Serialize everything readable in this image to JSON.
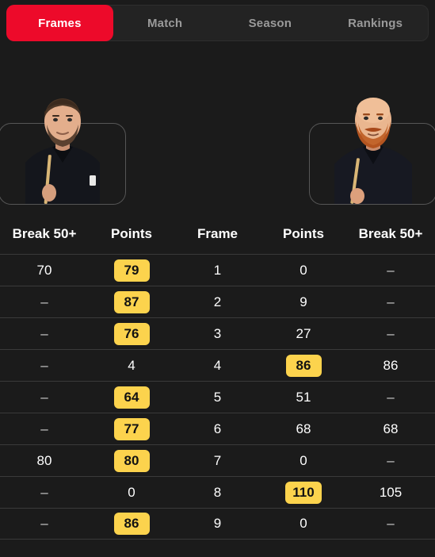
{
  "tabs": [
    {
      "label": "Frames",
      "active": true
    },
    {
      "label": "Match",
      "active": false
    },
    {
      "label": "Season",
      "active": false
    },
    {
      "label": "Rankings",
      "active": false
    }
  ],
  "players": {
    "left": {
      "icon": "player-photo-left",
      "description": "snooker player with dark hair and beard holding cue"
    },
    "right": {
      "icon": "player-photo-right",
      "description": "bald snooker player with ginger beard and bow tie holding cue"
    }
  },
  "table": {
    "headers": [
      "Break 50+",
      "Points",
      "Frame",
      "Points",
      "Break 50+"
    ],
    "rows": [
      {
        "left_break": "70",
        "left_points": "79",
        "left_won": true,
        "frame": "1",
        "right_points": "0",
        "right_won": false,
        "right_break": "–"
      },
      {
        "left_break": "–",
        "left_points": "87",
        "left_won": true,
        "frame": "2",
        "right_points": "9",
        "right_won": false,
        "right_break": "–"
      },
      {
        "left_break": "–",
        "left_points": "76",
        "left_won": true,
        "frame": "3",
        "right_points": "27",
        "right_won": false,
        "right_break": "–"
      },
      {
        "left_break": "–",
        "left_points": "4",
        "left_won": false,
        "frame": "4",
        "right_points": "86",
        "right_won": true,
        "right_break": "86"
      },
      {
        "left_break": "–",
        "left_points": "64",
        "left_won": true,
        "frame": "5",
        "right_points": "51",
        "right_won": false,
        "right_break": "–"
      },
      {
        "left_break": "–",
        "left_points": "77",
        "left_won": true,
        "frame": "6",
        "right_points": "68",
        "right_won": false,
        "right_break": "68"
      },
      {
        "left_break": "80",
        "left_points": "80",
        "left_won": true,
        "frame": "7",
        "right_points": "0",
        "right_won": false,
        "right_break": "–"
      },
      {
        "left_break": "–",
        "left_points": "0",
        "left_won": false,
        "frame": "8",
        "right_points": "110",
        "right_won": true,
        "right_break": "105"
      },
      {
        "left_break": "–",
        "left_points": "86",
        "left_won": true,
        "frame": "9",
        "right_points": "0",
        "right_won": false,
        "right_break": "–"
      }
    ]
  },
  "colors": {
    "background": "#1b1b1b",
    "accent_red": "#ed0a2a",
    "badge_yellow": "#fcd34d",
    "divider": "#3a3a3a",
    "inactive_text": "#9a9a9a"
  }
}
